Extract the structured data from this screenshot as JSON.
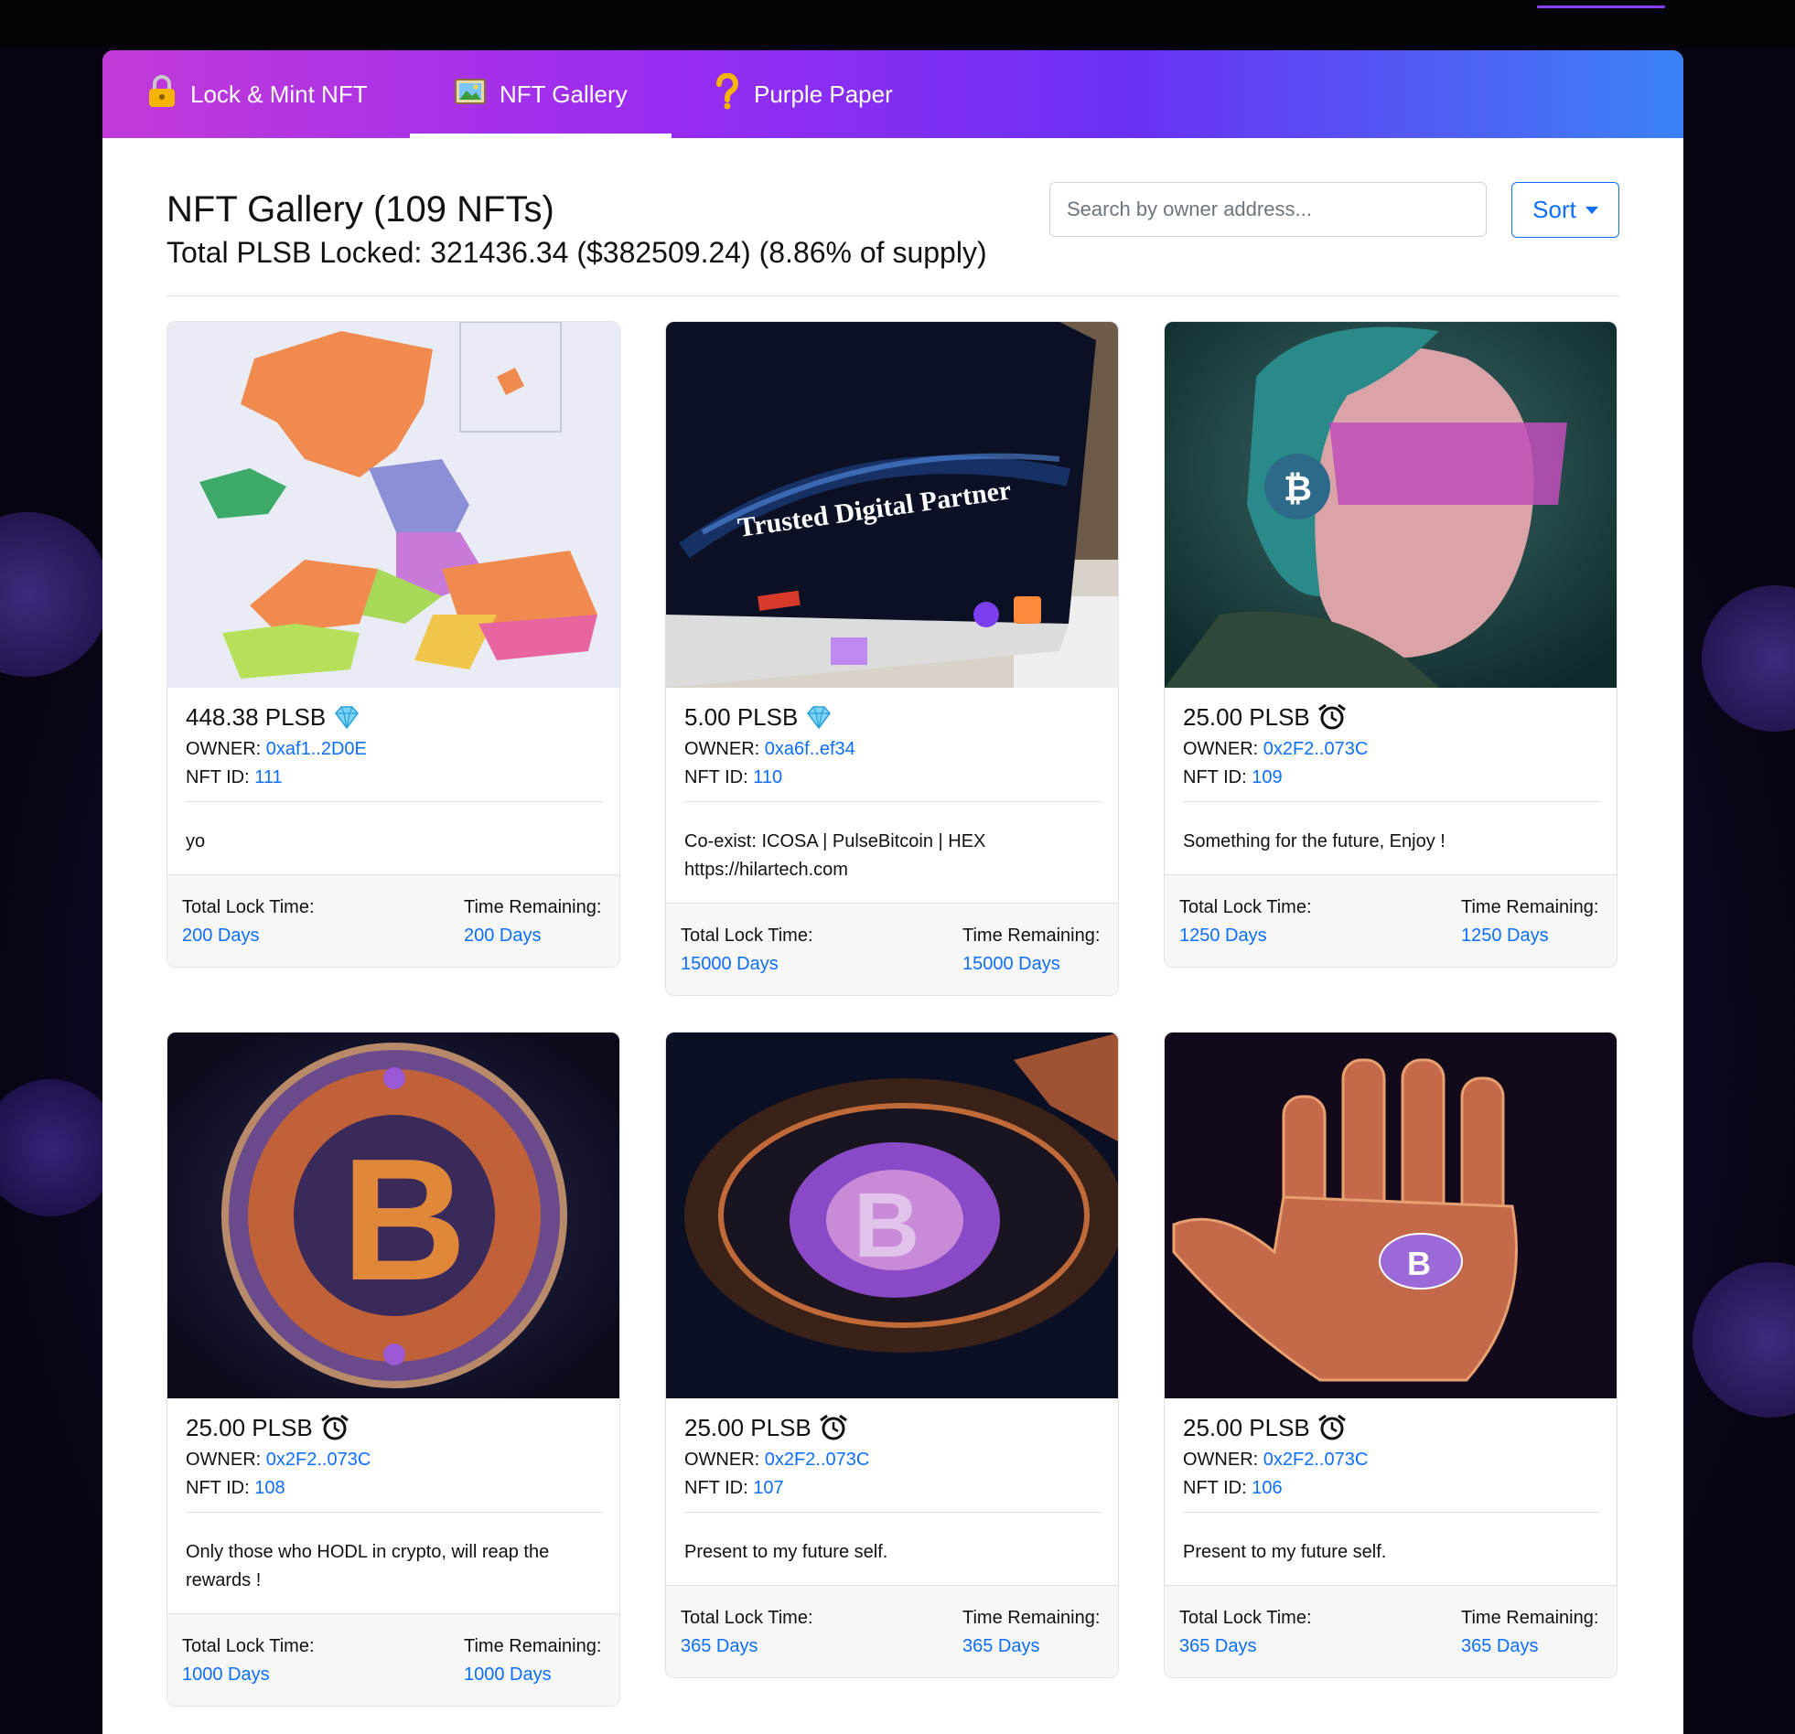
{
  "nav": {
    "tabs": [
      {
        "label": "Lock & Mint NFT",
        "icon": "lock-icon"
      },
      {
        "label": "NFT Gallery",
        "icon": "picture-icon",
        "active": true
      },
      {
        "label": "Purple Paper",
        "icon": "question-icon"
      }
    ]
  },
  "header": {
    "title": "NFT Gallery (109 NFTs)",
    "subtitle": "Total PLSB Locked: 321436.34 ($382509.24) (8.86% of supply)"
  },
  "search": {
    "placeholder": "Search by owner address...",
    "value": ""
  },
  "sort": {
    "label": "Sort"
  },
  "labels": {
    "owner": "OWNER:",
    "nft_id": "NFT ID:",
    "total_lock": "Total Lock Time:",
    "time_remaining": "Time Remaining:"
  },
  "cards": [
    {
      "amount": "448.38 PLSB",
      "badge": "diamond-icon",
      "owner": "0xaf1..2D0E",
      "nft_id": "111",
      "description": "yo",
      "total_lock": "200 Days",
      "time_remaining": "200 Days",
      "image": "uk-map-image"
    },
    {
      "amount": "5.00 PLSB",
      "badge": "diamond-icon",
      "owner": "0xa6f..ef34",
      "nft_id": "110",
      "description": "Co-exist: ICOSA | PulseBitcoin | HEX https://hilartech.com",
      "total_lock": "15000 Days",
      "time_remaining": "15000 Days",
      "image": "monitor-image",
      "image_text": "Trusted Digital Partner"
    },
    {
      "amount": "25.00 PLSB",
      "badge": "clock-icon",
      "owner": "0x2F2..073C",
      "nft_id": "109",
      "description": "Something for the future, Enjoy !",
      "total_lock": "1250 Days",
      "time_remaining": "1250 Days",
      "image": "woman-headphones-image"
    },
    {
      "amount": "25.00 PLSB",
      "badge": "clock-icon",
      "owner": "0x2F2..073C",
      "nft_id": "108",
      "description": "Only those who HODL in crypto, will reap the rewards !",
      "total_lock": "1000 Days",
      "time_remaining": "1000 Days",
      "image": "bitcoin-coin-image"
    },
    {
      "amount": "25.00 PLSB",
      "badge": "clock-icon",
      "owner": "0x2F2..073C",
      "nft_id": "107",
      "description": "Present to my future self.",
      "total_lock": "365 Days",
      "time_remaining": "365 Days",
      "image": "bitcoin-clock-image"
    },
    {
      "amount": "25.00 PLSB",
      "badge": "clock-icon",
      "owner": "0x2F2..073C",
      "nft_id": "106",
      "description": "Present to my future self.",
      "total_lock": "365 Days",
      "time_remaining": "365 Days",
      "image": "bitcoin-hand-image"
    }
  ],
  "colors": {
    "link": "#0d6efd",
    "nav_start": "#c13ad8",
    "nav_end": "#3b82f6"
  }
}
